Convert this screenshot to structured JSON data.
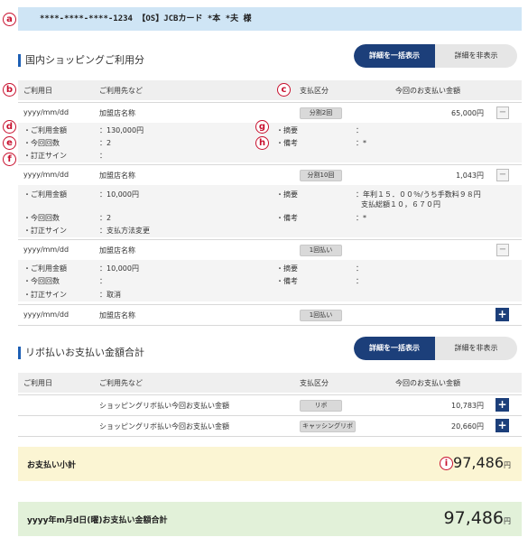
{
  "markers": {
    "a": "a",
    "b": "b",
    "c": "c",
    "d": "d",
    "e": "e",
    "f": "f",
    "g": "g",
    "h": "h",
    "i": "i"
  },
  "card": {
    "line": "****-****-****-1234 【OS】JCBカード *本 *夫 様"
  },
  "domestic": {
    "title": "国内ショッピングご利用分",
    "toggle_show": "詳細を一括表示",
    "toggle_hide": "詳細を非表示",
    "headers": {
      "date": "ご利用日",
      "merchant": "ご利用先など",
      "payment_type": "支払区分",
      "amount": "今回のお支払い金額"
    },
    "transactions": [
      {
        "date": "yyyy/mm/dd",
        "merchant": "加盟店名称",
        "payment_type": "分割2回",
        "amount": "65,000円",
        "button": "−",
        "details": {
          "usage_label": "・ご利用金額",
          "usage_value": "：130,000円",
          "count_label": "・今回回数",
          "count_value": "：2",
          "correction_label": "・訂正サイン",
          "correction_value": "：",
          "summary_label": "・摘要",
          "summary_value": "：",
          "note_label": "・備考",
          "note_value": "：*"
        }
      },
      {
        "date": "yyyy/mm/dd",
        "merchant": "加盟店名称",
        "payment_type": "分割10回",
        "amount": "1,043円",
        "button": "−",
        "details": {
          "usage_label": "・ご利用金額",
          "usage_value": "：10,000円",
          "count_label": "・今回回数",
          "count_value": "：2",
          "correction_label": "・訂正サイン",
          "correction_value": "：支払方法変更",
          "summary_label": "・摘要",
          "summary_value": "：年利１５．００％/うち手数料９８円",
          "summary_value2": "支払総額１０，６７０円",
          "note_label": "・備考",
          "note_value": "：*"
        }
      },
      {
        "date": "yyyy/mm/dd",
        "merchant": "加盟店名称",
        "payment_type": "1回払い",
        "amount": "",
        "button": "−",
        "details": {
          "usage_label": "・ご利用金額",
          "usage_value": "：10,000円",
          "count_label": "・今回回数",
          "count_value": "：",
          "correction_label": "・訂正サイン",
          "correction_value": "：取消",
          "summary_label": "・摘要",
          "summary_value": "：",
          "note_label": "・備考",
          "note_value": "："
        }
      },
      {
        "date": "yyyy/mm/dd",
        "merchant": "加盟店名称",
        "payment_type": "1回払い",
        "amount": "",
        "button": "+"
      }
    ]
  },
  "revolving": {
    "title": "リボ払いお支払い金額合計",
    "toggle_show": "詳細を一括表示",
    "toggle_hide": "詳細を非表示",
    "headers": {
      "date": "ご利用日",
      "merchant": "ご利用先など",
      "payment_type": "支払区分",
      "amount": "今回のお支払い金額"
    },
    "rows": [
      {
        "merchant": "ショッピングリボ払い今回お支払い金額",
        "payment_type": "リボ",
        "amount": "10,783円",
        "button": "+"
      },
      {
        "merchant": "ショッピングリボ払い今回お支払い金額",
        "payment_type": "キャッシングリボ",
        "amount": "20,660円",
        "button": "+"
      }
    ]
  },
  "subtotal": {
    "label": "お支払い小計",
    "amount": "97,486",
    "unit": "円"
  },
  "grand_total": {
    "label": "yyyy年m月d日(曜)お支払い金額合計",
    "amount": "97,486",
    "unit": "円"
  },
  "colors": {
    "accent": "#1c3f7a",
    "annotation": "#c8102e",
    "card_bar": "#cfe5f5",
    "subtotal_bg": "#fbf5d3",
    "grand_bg": "#e2f1d9"
  }
}
